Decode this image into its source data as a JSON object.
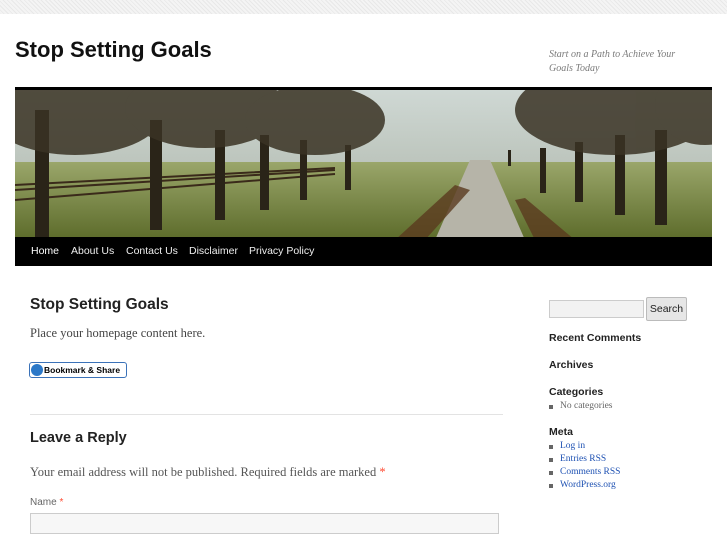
{
  "site": {
    "title": "Stop Setting Goals",
    "description": "Start on a Path to Achieve Your Goals Today"
  },
  "nav": {
    "items": [
      "Home",
      "About Us",
      "Contact Us",
      "Disclaimer",
      "Privacy Policy"
    ],
    "current": "Home"
  },
  "post": {
    "title": "Stop Setting Goals",
    "content": "Place your homepage content here.",
    "bookmark_label": "Bookmark & Share"
  },
  "comments": {
    "reply_title": "Leave a Reply",
    "note": "Your email address will not be published. Required fields are marked",
    "required_mark": "*",
    "name_label": "Name",
    "name_value": ""
  },
  "sidebar": {
    "search_value": "",
    "search_button": "Search",
    "recent_comments_title": "Recent Comments",
    "archives_title": "Archives",
    "categories_title": "Categories",
    "categories": [
      "No categories"
    ],
    "meta_title": "Meta",
    "meta_links": [
      "Log in",
      "Entries RSS",
      "Comments RSS",
      "WordPress.org"
    ]
  },
  "colors": {
    "nav_background": "#000000",
    "link": "#1f52b3",
    "required": "#ff4b33"
  }
}
